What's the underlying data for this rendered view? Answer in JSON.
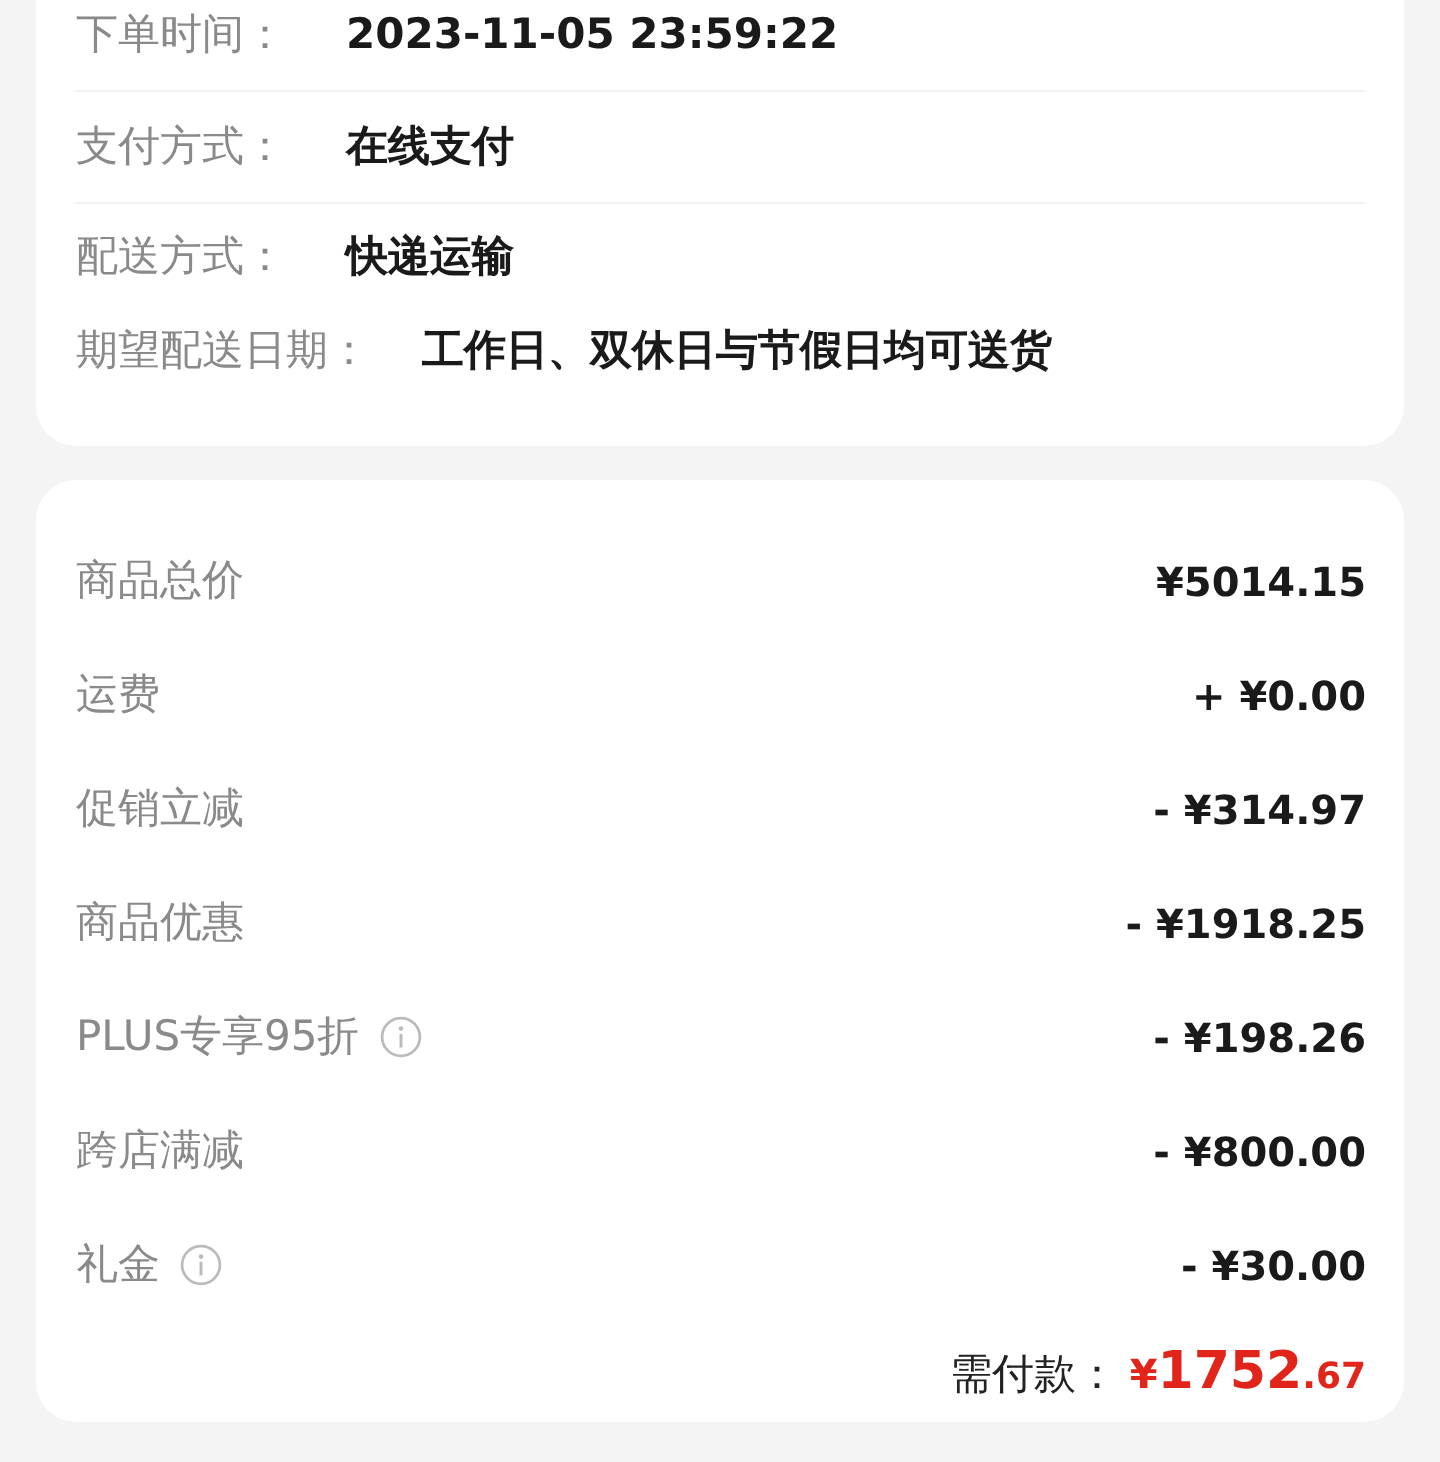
{
  "order_info": [
    {
      "label": "下单时间：",
      "value": "2023-11-05 23:59:22"
    },
    {
      "label": "支付方式：",
      "value": "在线支付"
    },
    {
      "label": "配送方式：",
      "value": "快递运输"
    },
    {
      "label": "期望配送日期：",
      "value": "工作日、双休日与节假日均可送货"
    }
  ],
  "price_summary": [
    {
      "label": "商品总价",
      "info": false,
      "amount": "¥5014.15"
    },
    {
      "label": "运费",
      "info": false,
      "amount": "+ ¥0.00"
    },
    {
      "label": "促销立减",
      "info": false,
      "amount": "- ¥314.97"
    },
    {
      "label": "商品优惠",
      "info": false,
      "amount": "- ¥1918.25"
    },
    {
      "label": "PLUS专享95折",
      "info": true,
      "amount": "- ¥198.26"
    },
    {
      "label": "跨店满减",
      "info": false,
      "amount": "- ¥800.00"
    },
    {
      "label": "礼金",
      "info": true,
      "amount": "- ¥30.00"
    }
  ],
  "total": {
    "label": "需付款：",
    "currency": "¥",
    "integer": "1752",
    "decimal": ".67"
  }
}
